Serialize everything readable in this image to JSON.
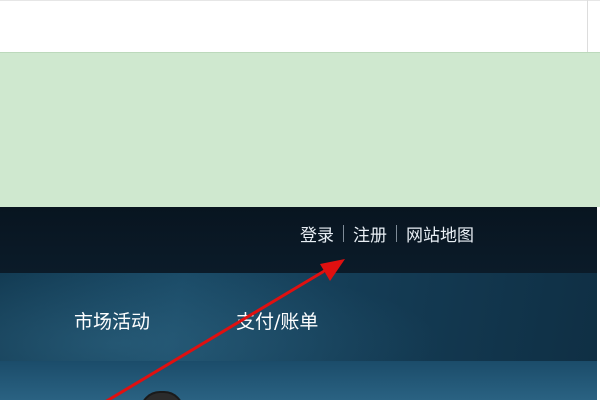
{
  "header": {
    "top_links": {
      "login": "登录",
      "register": "注册",
      "sitemap": "网站地图"
    },
    "nav": {
      "marketing": "市场活动",
      "payment_bills": "支付/账单"
    }
  },
  "annotation": {
    "type": "arrow",
    "color": "#e01010",
    "target": "register-link"
  }
}
